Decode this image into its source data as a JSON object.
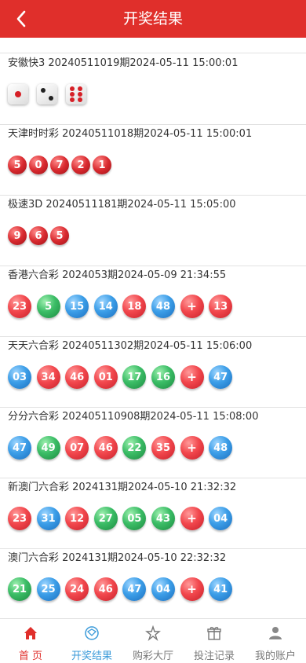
{
  "header": {
    "title": "开奖结果"
  },
  "results": [
    {
      "name": "安徽快3",
      "issue": "20240511019期",
      "time": "2024-05-11 15:00:01",
      "kind": "dice",
      "dice": [
        1,
        2,
        6
      ]
    },
    {
      "name": "天津时时彩",
      "issue": "20240511018期",
      "time": "2024-05-11 15:00:01",
      "kind": "small",
      "balls": [
        "5",
        "0",
        "7",
        "2",
        "1"
      ],
      "colors": [
        "dred",
        "dred",
        "dred",
        "dred",
        "dred"
      ]
    },
    {
      "name": "极速3D",
      "issue": "20240511181期",
      "time": "2024-05-11 15:05:00",
      "kind": "small",
      "balls": [
        "9",
        "6",
        "5"
      ],
      "colors": [
        "dred",
        "dred",
        "dred"
      ]
    },
    {
      "name": "香港六合彩",
      "issue": "2024053期",
      "time": "2024-05-09 21:34:55",
      "kind": "mark6",
      "balls": [
        "23",
        "5",
        "15",
        "14",
        "18",
        "48",
        "+",
        "13"
      ],
      "colors": [
        "red",
        "green",
        "blue",
        "blue",
        "red",
        "blue",
        "plus",
        "red"
      ]
    },
    {
      "name": "天天六合彩",
      "issue": "20240511302期",
      "time": "2024-05-11 15:06:00",
      "kind": "mark6",
      "balls": [
        "03",
        "34",
        "46",
        "01",
        "17",
        "16",
        "+",
        "47"
      ],
      "colors": [
        "blue",
        "red",
        "red",
        "red",
        "green",
        "green",
        "plus",
        "blue"
      ]
    },
    {
      "name": "分分六合彩",
      "issue": "202405110908期",
      "time": "2024-05-11 15:08:00",
      "kind": "mark6",
      "balls": [
        "47",
        "49",
        "07",
        "46",
        "22",
        "35",
        "+",
        "48"
      ],
      "colors": [
        "blue",
        "green",
        "red",
        "red",
        "green",
        "red",
        "plus",
        "blue"
      ]
    },
    {
      "name": "新澳门六合彩",
      "issue": "2024131期",
      "time": "2024-05-10 21:32:32",
      "kind": "mark6",
      "balls": [
        "23",
        "31",
        "12",
        "27",
        "05",
        "43",
        "+",
        "04"
      ],
      "colors": [
        "red",
        "blue",
        "red",
        "green",
        "green",
        "green",
        "plus",
        "blue"
      ]
    },
    {
      "name": "澳门六合彩",
      "issue": "2024131期",
      "time": "2024-05-10 22:32:32",
      "kind": "mark6",
      "balls": [
        "21",
        "25",
        "24",
        "46",
        "47",
        "04",
        "+",
        "41"
      ],
      "colors": [
        "green",
        "blue",
        "red",
        "red",
        "blue",
        "blue",
        "plus",
        "blue"
      ]
    }
  ],
  "tabbar": {
    "items": [
      {
        "label": "首 页",
        "icon": "home-icon",
        "state": "home"
      },
      {
        "label": "开奖结果",
        "icon": "award-icon",
        "state": "active"
      },
      {
        "label": "购彩大厅",
        "icon": "lobby-icon",
        "state": "normal"
      },
      {
        "label": "投注记录",
        "icon": "gift-icon",
        "state": "normal"
      },
      {
        "label": "我的账户",
        "icon": "user-icon",
        "state": "normal"
      }
    ]
  },
  "colors": {
    "header": "#e02f2b",
    "active_tab": "#3a9ad9",
    "home_tab": "#e02f2b"
  }
}
